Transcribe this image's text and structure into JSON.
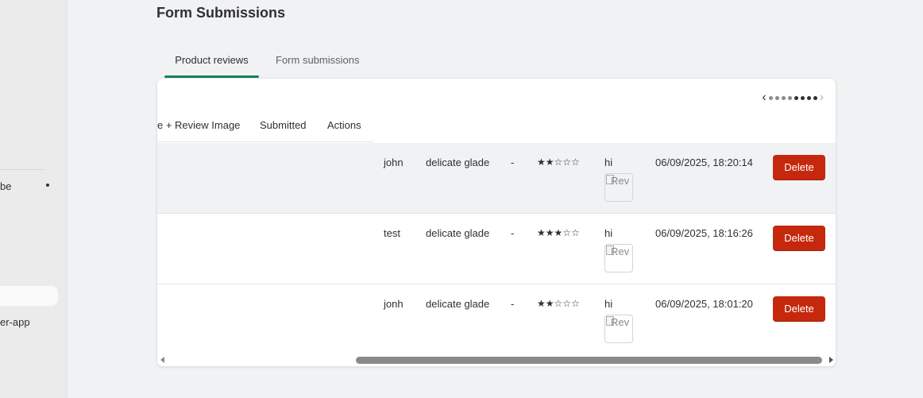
{
  "sidebar": {
    "item_partial_1": "be",
    "item_partial_2": "er-app"
  },
  "page": {
    "title": "Form Submissions"
  },
  "tabs": [
    {
      "label": "Product reviews",
      "active": true
    },
    {
      "label": "Form submissions",
      "active": false
    }
  ],
  "pagination": {
    "prev": "‹",
    "next": "›",
    "total_dots": 8,
    "active_from": 4
  },
  "table": {
    "headers": {
      "title_image": "e + Review Image",
      "submitted": "Submitted",
      "actions": "Actions"
    },
    "rows": [
      {
        "name": "john",
        "product": "delicate glade",
        "dash": "-",
        "stars": "★★☆☆☆",
        "rating": 2,
        "text": "hi",
        "img_alt": "Rev",
        "date": "06/09/2025, 18:20:14",
        "action": "Delete"
      },
      {
        "name": "test",
        "product": "delicate glade",
        "dash": "-",
        "stars": "★★★☆☆",
        "rating": 3,
        "text": "hi",
        "img_alt": "Rev",
        "date": "06/09/2025, 18:16:26",
        "action": "Delete"
      },
      {
        "name": "jonh",
        "product": "delicate glade",
        "dash": "-",
        "stars": "★★☆☆☆",
        "rating": 2,
        "text": "hi",
        "img_alt": "Rev",
        "date": "06/09/2025, 18:01:20",
        "action": "Delete"
      }
    ]
  },
  "colors": {
    "accent": "#1a7f5a",
    "danger": "#c5280c",
    "bg": "#f1f2f4"
  }
}
